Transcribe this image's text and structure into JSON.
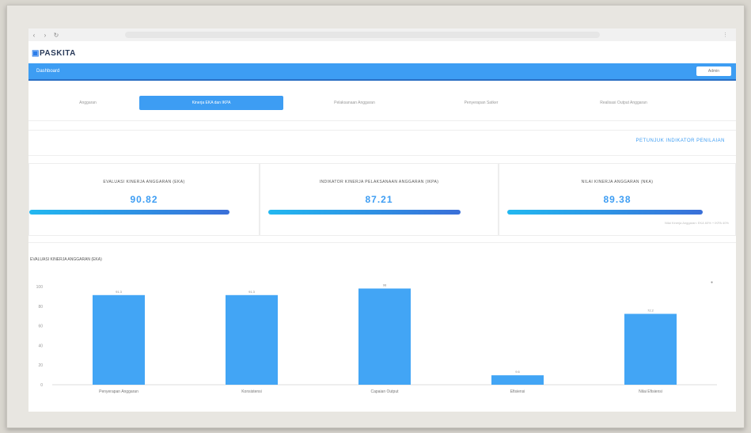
{
  "app": {
    "logo": "PASKITA"
  },
  "topnav": {
    "brand": "Dashboard",
    "user_button": "Admin"
  },
  "tabs": [
    {
      "label": "Anggaran",
      "active": false
    },
    {
      "label": "Kinerja EKA dan IKPA",
      "active": true
    },
    {
      "label": "Pelaksanaan Anggaran",
      "active": false
    },
    {
      "label": "Penyerapan Satker",
      "active": false
    },
    {
      "label": "Realisasi Output Anggaran",
      "active": false
    }
  ],
  "link_right": "PETUNJUK INDIKATOR PENILAIAN",
  "cards": [
    {
      "title": "EVALUASI KINERJA ANGGARAN (EKA)",
      "value": "90.82",
      "fill": 0.9
    },
    {
      "title": "INDIKATOR KINERJA PELAKSANAAN ANGGARAN (IKPA)",
      "value": "87.21",
      "fill": 0.86
    },
    {
      "title": "NILAI KINERJA ANGGARAN (NKA)",
      "value": "89.38",
      "fill": 0.88,
      "note": "Nilai Kinerja Anggaran: EKA 60% + IKPA 40%"
    }
  ],
  "chart_title": "EVALUASI KINERJA ANGGARAN (EKA)",
  "colors": {
    "accent": "#3d9df3",
    "nav": "#3d9df3",
    "bar": "#42a5f5"
  },
  "chart_data": {
    "type": "bar",
    "title": "",
    "categories": [
      "Penyerapan Anggaran",
      "Konsistensi",
      "Capaian Output",
      "Efisiensi",
      "Nilai Efisiensi"
    ],
    "values": [
      91.3,
      91.3,
      98.0,
      9.6,
      72.2
    ],
    "ylim": [
      0,
      100
    ],
    "yticks": [
      0,
      20,
      40,
      60,
      80,
      100
    ],
    "grid": false
  }
}
